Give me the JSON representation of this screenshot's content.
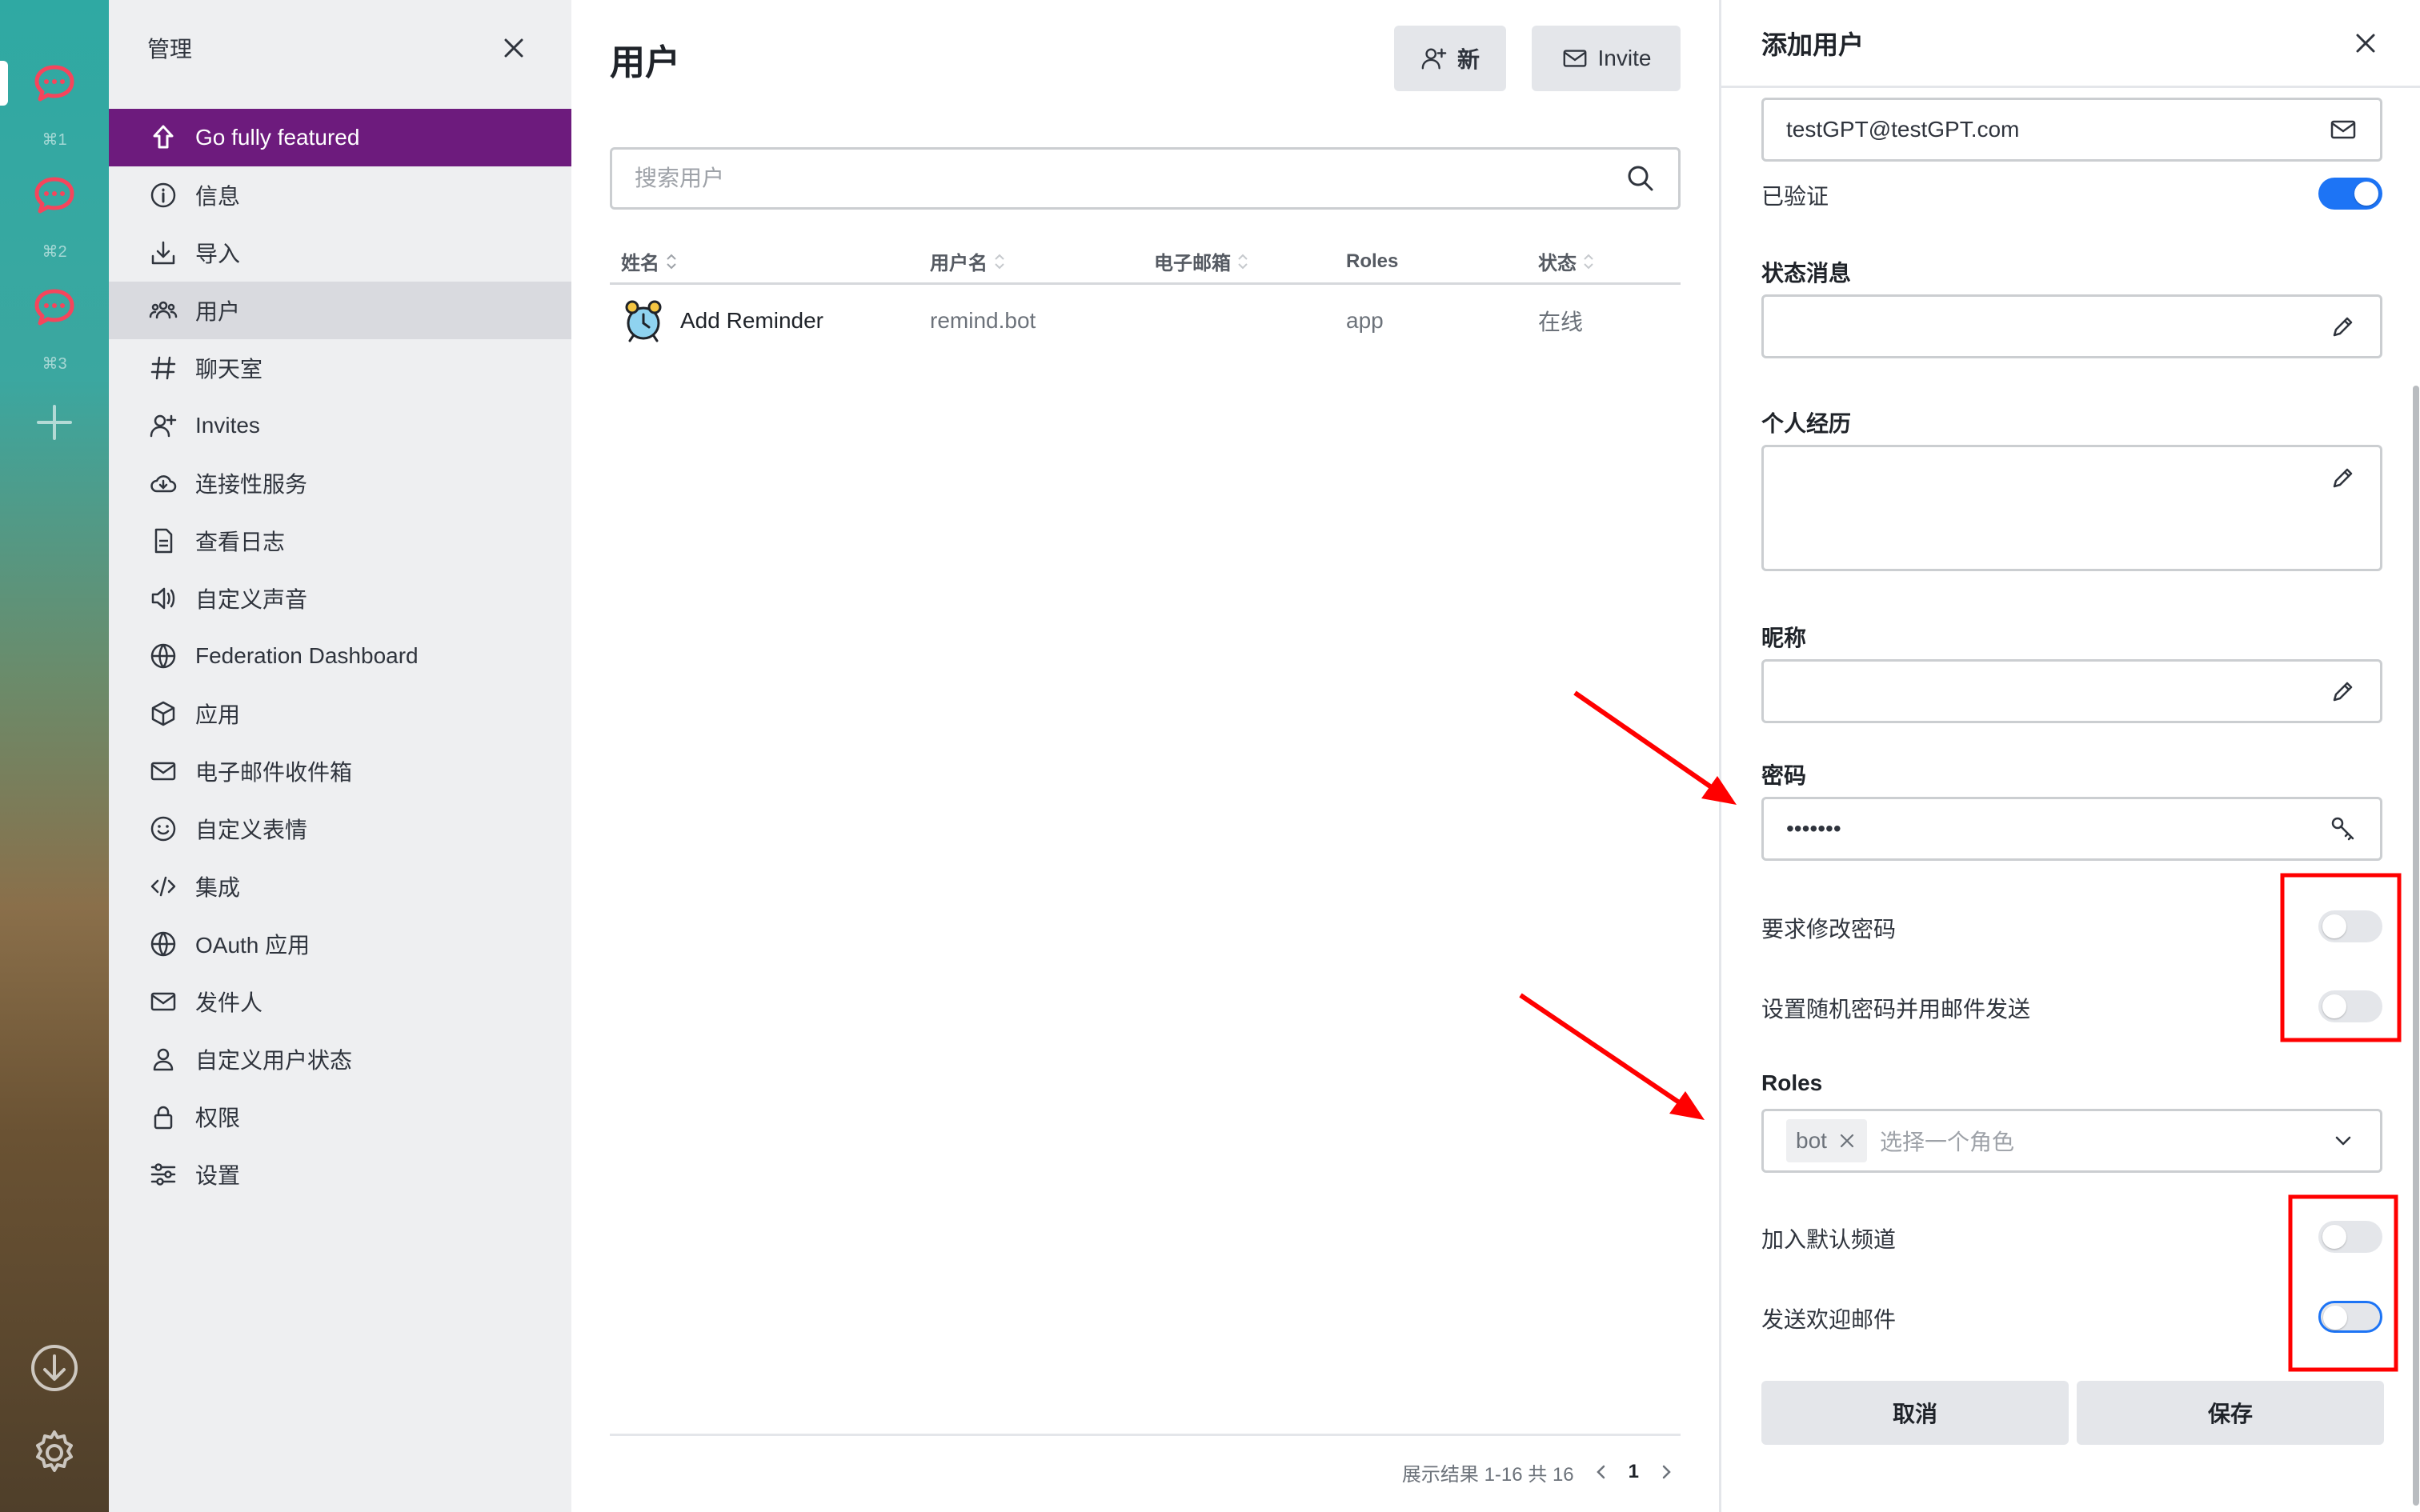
{
  "rail": {
    "workspaces": [
      {
        "shortcut": "⌘1",
        "icon": "chat-logo-icon"
      },
      {
        "shortcut": "⌘2",
        "icon": "chat-logo-icon"
      },
      {
        "shortcut": "⌘3",
        "icon": "chat-logo-icon"
      }
    ]
  },
  "sidebar": {
    "title": "管理",
    "promo_label": "Go fully featured",
    "items": [
      {
        "label": "信息",
        "icon": "info-icon"
      },
      {
        "label": "导入",
        "icon": "import-icon"
      },
      {
        "label": "用户",
        "icon": "users-icon"
      },
      {
        "label": "聊天室",
        "icon": "hashtag-icon"
      },
      {
        "label": "Invites",
        "icon": "user-plus-icon"
      },
      {
        "label": "连接性服务",
        "icon": "cloud-icon"
      },
      {
        "label": "查看日志",
        "icon": "document-icon"
      },
      {
        "label": "自定义声音",
        "icon": "speaker-icon"
      },
      {
        "label": "Federation Dashboard",
        "icon": "globe-icon"
      },
      {
        "label": "应用",
        "icon": "cube-icon"
      },
      {
        "label": "电子邮件收件箱",
        "icon": "mail-icon"
      },
      {
        "label": "自定义表情",
        "icon": "emoji-icon"
      },
      {
        "label": "集成",
        "icon": "code-icon"
      },
      {
        "label": "OAuth 应用",
        "icon": "globe-icon"
      },
      {
        "label": "发件人",
        "icon": "mail-icon"
      },
      {
        "label": "自定义用户状态",
        "icon": "user-icon"
      },
      {
        "label": "权限",
        "icon": "lock-icon"
      },
      {
        "label": "设置",
        "icon": "sliders-icon"
      }
    ]
  },
  "main": {
    "title": "用户",
    "new_label": "新",
    "invite_label": "Invite",
    "search_placeholder": "搜索用户",
    "columns": [
      "姓名",
      "用户名",
      "电子邮箱",
      "Roles",
      "状态"
    ],
    "rows": [
      {
        "name": "Add Reminder",
        "username": "remind.bot",
        "email": "",
        "roles": "app",
        "status": "在线"
      }
    ],
    "pagination_text": "展示结果 1-16 共 16",
    "current_page": "1"
  },
  "panel": {
    "title": "添加用户",
    "email_value": "testGPT@testGPT.com",
    "verified_label": "已验证",
    "status_label": "状态消息",
    "bio_label": "个人经历",
    "nickname_label": "昵称",
    "password_label": "密码",
    "password_value": "testGPT",
    "require_change_label": "要求修改密码",
    "random_password_label": "设置随机密码并用邮件发送",
    "roles_label": "Roles",
    "role_chip": "bot",
    "roles_placeholder": "选择一个角色",
    "join_default_label": "加入默认频道",
    "welcome_email_label": "发送欢迎邮件",
    "cancel_label": "取消",
    "save_label": "保存",
    "toggles": {
      "verified": true,
      "require_change": false,
      "random_password": false,
      "join_default": false,
      "welcome_email": false
    }
  },
  "colors": {
    "promo": "#6d1b7d",
    "toggle_on": "#1d74f5",
    "annotation": "#ff0000"
  }
}
